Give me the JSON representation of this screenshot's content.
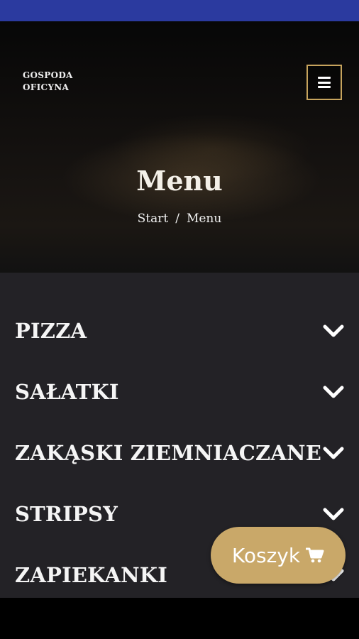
{
  "colors": {
    "status_bar": "#2b3a9f",
    "accent_gold": "#c9a869",
    "menu_border": "#c7a45d",
    "content_bg": "#232226"
  },
  "header": {
    "brand_line1": "GOSPODA",
    "brand_line2": "OFICYNA",
    "menu_icon": "hamburger-icon"
  },
  "hero": {
    "title": "Menu",
    "breadcrumb": {
      "home": "Start",
      "separator": "/",
      "current": "Menu"
    }
  },
  "categories": [
    {
      "label": "PIZZA",
      "icon": "chevron-down-icon"
    },
    {
      "label": "SAŁATKI",
      "icon": "chevron-down-icon"
    },
    {
      "label": "ZAKĄSKI ZIEMNIACZANE",
      "icon": "chevron-down-icon"
    },
    {
      "label": "STRIPSY",
      "icon": "chevron-down-icon"
    },
    {
      "label": "ZAPIEKANKI",
      "icon": "chevron-down-icon"
    }
  ],
  "cart": {
    "label": "Koszyk",
    "icon": "shopping-cart-icon"
  }
}
